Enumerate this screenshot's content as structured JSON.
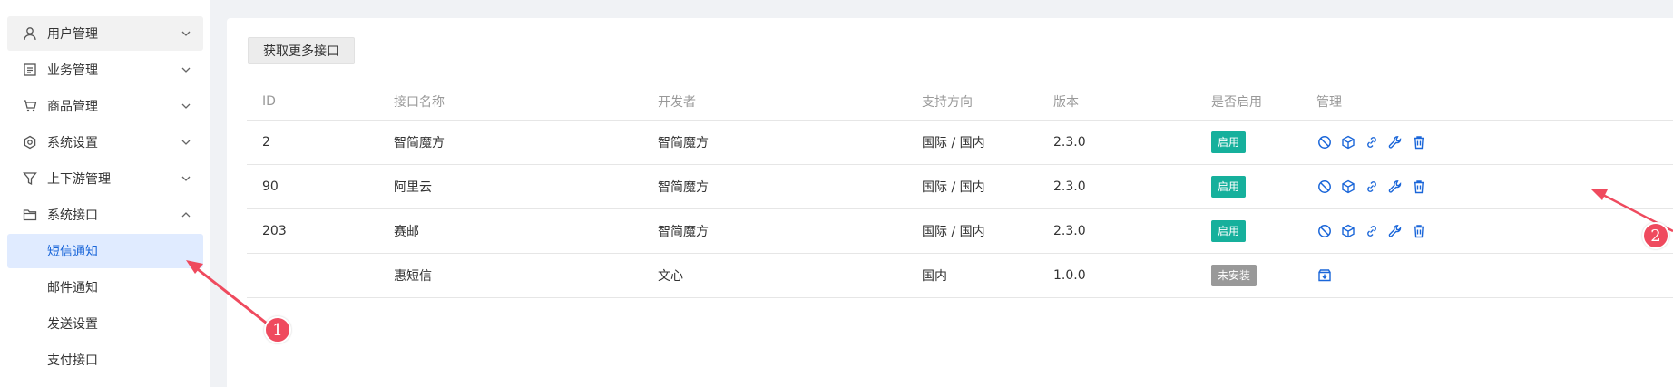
{
  "sidebar": {
    "items": [
      {
        "label": "用户管理",
        "icon": "user-icon",
        "expanded": false
      },
      {
        "label": "业务管理",
        "icon": "document-icon",
        "expanded": false
      },
      {
        "label": "商品管理",
        "icon": "cart-icon",
        "expanded": false
      },
      {
        "label": "系统设置",
        "icon": "settings-icon",
        "expanded": false
      },
      {
        "label": "上下游管理",
        "icon": "filter-icon",
        "expanded": false
      },
      {
        "label": "系统接口",
        "icon": "folder-icon",
        "expanded": true
      }
    ],
    "subitems": [
      {
        "label": "短信通知",
        "active": true
      },
      {
        "label": "邮件通知",
        "active": false
      },
      {
        "label": "发送设置",
        "active": false
      },
      {
        "label": "支付接口",
        "active": false
      }
    ]
  },
  "toolbar": {
    "more_label": "获取更多接口"
  },
  "table": {
    "headers": [
      "ID",
      "接口名称",
      "开发者",
      "支持方向",
      "版本",
      "是否启用",
      "管理"
    ],
    "rows": [
      {
        "id": "2",
        "name": "智简魔方",
        "developer": "智简魔方",
        "direction": "国际 / 国内",
        "version": "2.3.0",
        "status": "启用",
        "installed": true
      },
      {
        "id": "90",
        "name": "阿里云",
        "developer": "智简魔方",
        "direction": "国际 / 国内",
        "version": "2.3.0",
        "status": "启用",
        "installed": true
      },
      {
        "id": "203",
        "name": "赛邮",
        "developer": "智简魔方",
        "direction": "国际 / 国内",
        "version": "2.3.0",
        "status": "启用",
        "installed": true
      },
      {
        "id": "",
        "name": "惠短信",
        "developer": "文心",
        "direction": "国内",
        "version": "1.0.0",
        "status": "未安装",
        "installed": false
      }
    ]
  },
  "annotations": {
    "marker1": "1",
    "marker2": "2"
  },
  "colors": {
    "accent_blue": "#1a66d9",
    "status_on": "#16b09c",
    "status_off": "#999999",
    "marker": "#ef4a5e"
  }
}
